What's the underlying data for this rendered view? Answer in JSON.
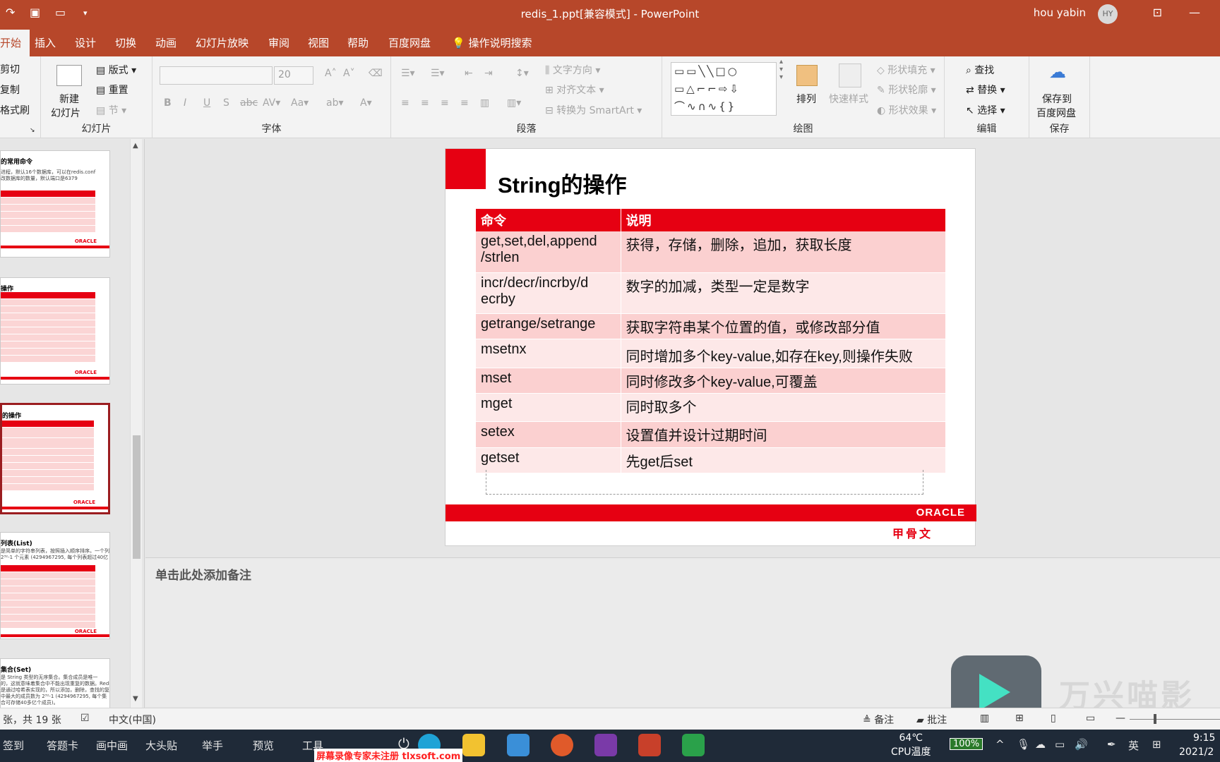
{
  "titlebar": {
    "doc_title": "redis_1.ppt[兼容模式]  -  PowerPoint",
    "user_name": "hou yabin",
    "avatar_initials": "HY"
  },
  "tabs": [
    "开始",
    "插入",
    "设计",
    "切换",
    "动画",
    "幻灯片放映",
    "审阅",
    "视图",
    "帮助",
    "百度网盘"
  ],
  "tell_me": "操作说明搜索",
  "ribbon": {
    "clipboard": {
      "cut": "剪切",
      "copy": "复制",
      "format_painter": "格式刷"
    },
    "slides": {
      "new_slide_1": "新建",
      "new_slide_2": "幻灯片",
      "layout": "版式",
      "reset": "重置",
      "section": "节",
      "label": "幻灯片"
    },
    "font": {
      "size": "20",
      "label": "字体"
    },
    "paragraph": {
      "text_direction": "文字方向",
      "align_text": "对齐文本",
      "smartart": "转换为 SmartArt",
      "label": "段落"
    },
    "drawing": {
      "arrange": "排列",
      "quick_styles": "快速样式",
      "shape_fill": "形状填充",
      "shape_outline": "形状轮廓",
      "shape_effects": "形状效果",
      "label": "绘图"
    },
    "editing": {
      "find": "查找",
      "replace": "替换",
      "select": "选择",
      "label": "编辑"
    },
    "save": {
      "line1": "保存到",
      "line2": "百度网盘",
      "label": "保存"
    }
  },
  "thumbnails": [
    {
      "title": "的常用命令",
      "body": "进程，默认16个数据库，可以在redis.conf\n改数据库的数量，默认端口是6379"
    },
    {
      "title": "操作",
      "body": ""
    },
    {
      "title": "的操作",
      "body": ""
    },
    {
      "title": "列表(List)",
      "body": "是简单的字符串列表，按照插入顺序排序。一个列表\n2³²-1 个元素 (4294967295, 每个列表超过40亿"
    },
    {
      "title": "集合(Set)",
      "body": "是 String 类型的无序集合。集合成员是唯一\n的，这就意味着集合中不能出现重复的数据。Redis 中集合\n是通过哈希表实现的，所以添加，删除，查找的复杂度都是\n中最大的成员数为 2³²-1 (4294967295, 每个集\n合可存储40多亿个成员)。"
    }
  ],
  "slide": {
    "title": "String的操作",
    "headers": [
      "命令",
      "说明"
    ],
    "rows": [
      {
        "cmd": "get,set,del,append\n/strlen",
        "desc": "获得，存储，删除，追加，获取长度"
      },
      {
        "cmd": "incr/decr/incrby/d\necrby",
        "desc": "数字的加减，类型一定是数字"
      },
      {
        "cmd": "getrange/setrange",
        "desc": "获取字符串某个位置的值，或修改部分值"
      },
      {
        "cmd": "msetnx",
        "desc": "同时增加多个key-value,如存在key,则操作失败"
      },
      {
        "cmd": "mset",
        "desc": "同时修改多个key-value,可覆盖"
      },
      {
        "cmd": "mget",
        "desc": "同时取多个"
      },
      {
        "cmd": "setex",
        "desc": "设置值并设计过期时间"
      },
      {
        "cmd": "getset",
        "desc": "先get后set"
      }
    ],
    "brand": "ORACLE",
    "brand_cn": "甲骨文"
  },
  "notes_placeholder": "单击此处添加备注",
  "statusbar": {
    "slide_count": "张，共 19 张",
    "language": "中文(中国)",
    "notes": "备注",
    "comments": "批注"
  },
  "watermark": "万兴喵影",
  "taskbar": {
    "items": [
      "签到",
      "答题卡",
      "画中画",
      "大头贴",
      "举手",
      "预览",
      "工具"
    ],
    "temp": "64℃",
    "cpu_label": "CPU温度",
    "battery": "100%",
    "ime": "英",
    "time": "9:15",
    "date": "2021/2",
    "banner": "屏幕录像专家未注册 tlxsoft.com"
  },
  "colors": {
    "accent": "#b7472a",
    "slide_red": "#e60012",
    "row_odd": "#fbd0d0",
    "row_even": "#fde8e8"
  }
}
